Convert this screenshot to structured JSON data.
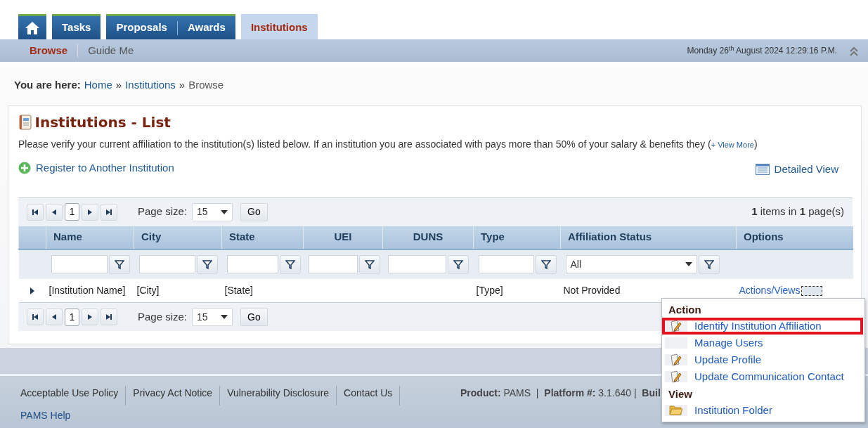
{
  "nav": {
    "tabs": [
      {
        "kind": "home",
        "selected": false
      },
      {
        "kind": "text",
        "label": "Tasks",
        "selected": false
      },
      {
        "kind": "pair",
        "labels": [
          "Proposals",
          "Awards"
        ],
        "selected": false
      },
      {
        "kind": "text",
        "label": "Institutions",
        "selected": true
      }
    ],
    "subtabs": [
      {
        "label": "Browse",
        "selected": true
      },
      {
        "label": "Guide Me",
        "selected": false
      }
    ],
    "datetime": "Monday 26$^{th}$ August 2024 12:29:16 P.M."
  },
  "breadcrumb": {
    "label": "You are here:",
    "separator": "»",
    "items": [
      "Home",
      "Institutions"
    ],
    "current": "Browse"
  },
  "panel": {
    "title": "Institutions - List",
    "intro": {
      "text": "Please verify your current affiliation to the institution(s) listed below. If an institution you are associated with pays more than 50% of your salary & benefits they (",
      "link": "+ View More",
      "after": ")"
    },
    "register_link": "Register to Another Institution",
    "detailed_view_link": "Detailed View"
  },
  "grid": {
    "pagers": [
      {
        "page": "1",
        "page_size_label": "Page size:",
        "page_size": "15",
        "go": "Go",
        "summary": "**1** items in **1** page(s)"
      },
      {
        "page": "1",
        "page_size_label": "Page size:",
        "page_size": "15",
        "go": "Go"
      }
    ],
    "columns": [
      {
        "label": "Name",
        "kind": "text-filter"
      },
      {
        "label": "City",
        "kind": "text-filter"
      },
      {
        "label": "State",
        "kind": "text-filter"
      },
      {
        "label": "UEI",
        "kind": "text-filter"
      },
      {
        "label": "DUNS",
        "kind": "text-filter"
      },
      {
        "label": "Type",
        "kind": "text-filter"
      },
      {
        "label": "Affiliation Status",
        "kind": "select-filter",
        "filter_value": "All"
      },
      {
        "label": "Options",
        "kind": "no-filter"
      }
    ],
    "rows": [
      {
        "expanded": false,
        "cells": [
          "[Institution Name]",
          "[City]",
          "[State]",
          null,
          null,
          "[Type]",
          "Not Provided"
        ],
        "options": "Actions/Views"
      }
    ]
  },
  "menu": {
    "sections": [
      {
        "title": "Action",
        "items": [
          {
            "label": "Identify Institution Affiliation",
            "kind": "edit",
            "selected": true
          },
          {
            "label": "Manage Users",
            "kind": "plain",
            "selected": false
          },
          {
            "label": "Update Profile",
            "kind": "edit",
            "selected": false
          },
          {
            "label": "Update Communication Contact",
            "kind": "edit",
            "selected": false
          }
        ]
      },
      {
        "title": "View",
        "items": [
          {
            "label": "Institution Folder",
            "kind": "folder",
            "selected": false
          }
        ]
      }
    ]
  },
  "footer": {
    "links": [
      "Acceptable Use Policy",
      "Privacy Act Notice",
      "Vulnerability Disclosure",
      "Contact Us",
      "PAMS Help"
    ],
    "meta": "**Product:** PAMS  |  **Platform #:** 3.1.640 |  **Buil**"
  }
}
